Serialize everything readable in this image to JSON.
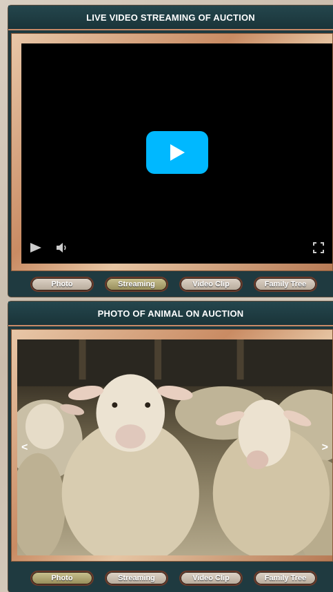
{
  "video_panel": {
    "title": "LIVE VIDEO STREAMING OF AUCTION",
    "player": {
      "big_play_icon": "play-icon",
      "play_icon": "play-icon",
      "volume_icon": "volume-icon",
      "fullscreen_icon": "fullscreen-icon",
      "accent_color": "#00b8ff"
    },
    "tabs": [
      {
        "label": "Photo",
        "active": false
      },
      {
        "label": "Streaming",
        "active": true
      },
      {
        "label": "Video Clip",
        "active": false
      },
      {
        "label": "Family Tree",
        "active": false
      }
    ]
  },
  "photo_panel": {
    "title": "PHOTO OF ANIMAL ON AUCTION",
    "prev_arrow": "<",
    "next_arrow": ">",
    "tabs": [
      {
        "label": "Photo",
        "active": true
      },
      {
        "label": "Streaming",
        "active": false
      },
      {
        "label": "Video Clip",
        "active": false
      },
      {
        "label": "Family Tree",
        "active": false
      }
    ]
  }
}
